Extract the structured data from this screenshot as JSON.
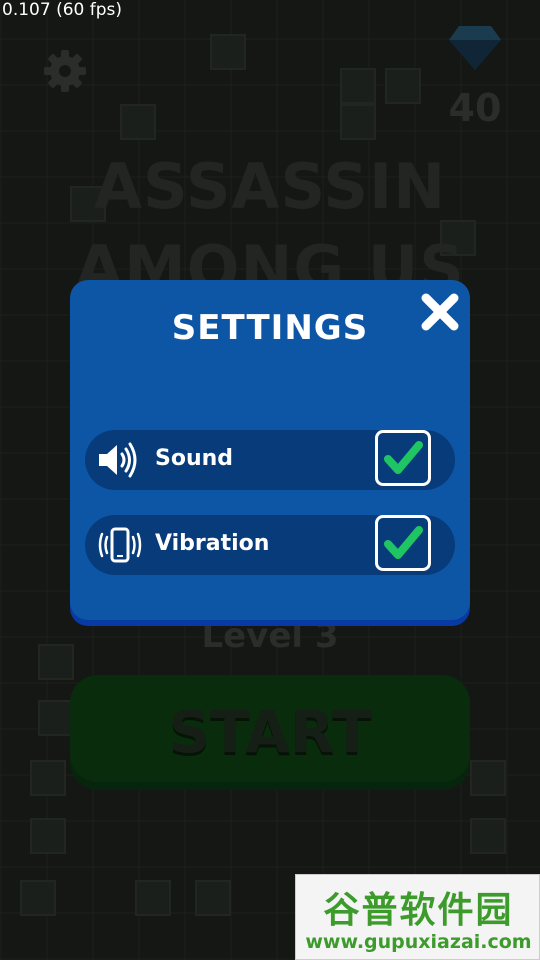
{
  "debug": {
    "fps_text": "0.107 (60 fps)"
  },
  "header": {
    "gem_count": "40",
    "settings_icon": "gear-icon",
    "currency_icon": "diamond-icon"
  },
  "background": {
    "title_line1": "ASSASSIN",
    "title_line2": "AMONG US",
    "level_label": "Level 3",
    "start_label": "START"
  },
  "settings": {
    "title": "SETTINGS",
    "close_icon": "close-icon",
    "options": [
      {
        "label": "Sound",
        "icon": "speaker-icon",
        "checked": true
      },
      {
        "label": "Vibration",
        "icon": "phone-vibrate-icon",
        "checked": true
      }
    ]
  },
  "watermark": {
    "text": "谷普软件园",
    "url": "www.gupuxiazai.com"
  },
  "colors": {
    "panel": "#0d56a6",
    "row": "#073b7a",
    "check": "#1fc563",
    "start": "#0c3d10"
  }
}
